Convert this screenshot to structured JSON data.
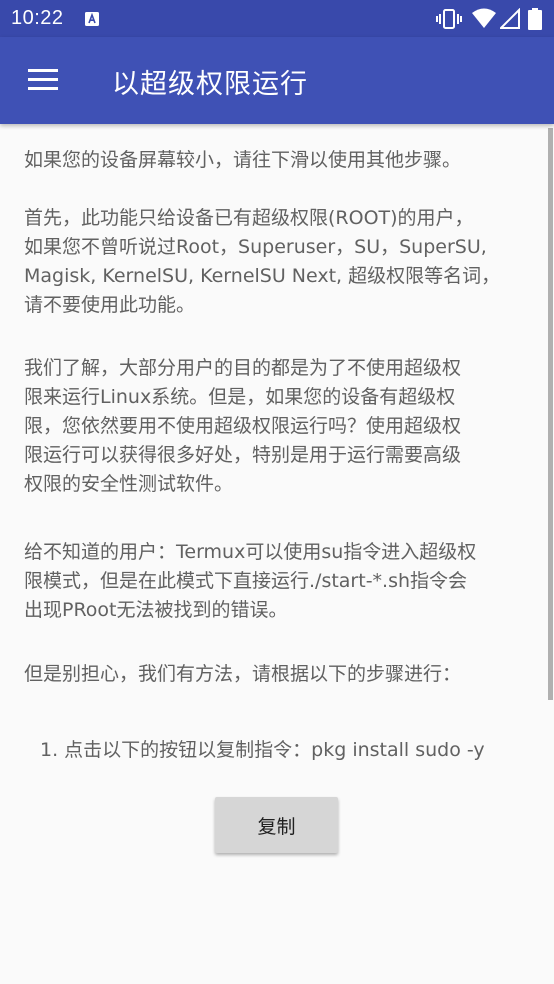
{
  "status_bar": {
    "time": "10:22",
    "notification_icon": "a-box-icon",
    "icons": [
      "vibrate-icon",
      "wifi-icon",
      "signal-icon",
      "battery-icon"
    ]
  },
  "app_bar": {
    "title": "以超级权限运行",
    "menu_icon": "hamburger-menu-icon"
  },
  "content": {
    "paragraphs": [
      "如果您的设备屏幕较小，请往下滑以使用其他步骤。",
      "首先，此功能只给设备已有超级权限(ROOT)的用户，\n如果您不曾听说过Root，Superuser，SU，SuperSU,\nMagisk, KernelSU, KernelSU Next, 超级权限等名词，\n请不要使用此功能。",
      "我们了解，大部分用户的目的都是为了不使用超级权\n限来运行Linux系统。但是，如果您的设备有超级权\n限，您依然要用不使用超级权限运行吗？使用超级权\n限运行可以获得很多好处，特别是用于运行需要高级\n权限的安全性测试软件。",
      "给不知道的用户：Termux可以使用su指令进入超级权\n限模式，但是在此模式下直接运行./start-*.sh指令会\n出现PRoot无法被找到的错误。",
      "但是别担心，我们有方法，请根据以下的步骤进行："
    ],
    "step_1": "1. 点击以下的按钮以复制指令：pkg install sudo -y",
    "copy_button_label": "复制"
  },
  "colors": {
    "status_bar": "#3949ab",
    "app_bar": "#3f51b5",
    "background": "#fafafa",
    "text": "#616161",
    "button": "#d6d6d6"
  }
}
